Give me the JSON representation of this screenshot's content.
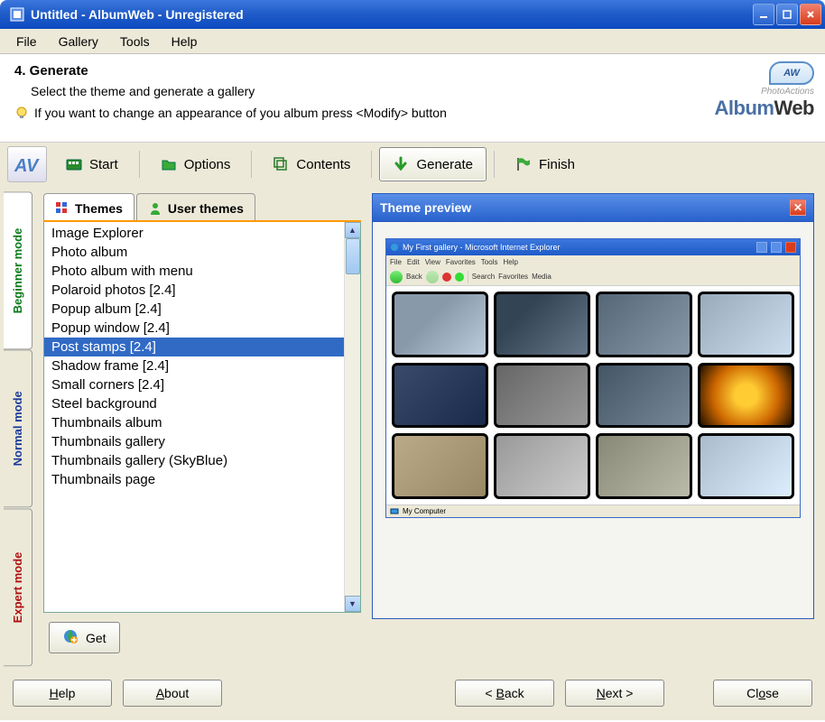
{
  "window": {
    "title": "Untitled - AlbumWeb - Unregistered"
  },
  "menubar": [
    "File",
    "Gallery",
    "Tools",
    "Help"
  ],
  "header": {
    "step": "4. Generate",
    "subtitle": "Select the theme and generate a gallery",
    "tip": "If you want to change an appearance of you album press <Modify> button",
    "brand_small": "PhotoActions",
    "brand_album": "Album",
    "brand_web": "Web",
    "brand_aw": "AW"
  },
  "toolbar": {
    "start": "Start",
    "options": "Options",
    "contents": "Contents",
    "generate": "Generate",
    "finish": "Finish"
  },
  "modes": {
    "beginner": "Beginner mode",
    "normal": "Normal mode",
    "expert": "Expert mode"
  },
  "tabs": {
    "themes": "Themes",
    "user_themes": "User themes"
  },
  "themes_list": [
    "Image Explorer",
    "Photo album",
    "Photo album with menu",
    "Polaroid photos [2.4]",
    "Popup album [2.4]",
    "Popup window [2.4]",
    "Post stamps [2.4]",
    "Shadow frame [2.4]",
    "Small corners [2.4]",
    "Steel background",
    "Thumbnails album",
    "Thumbnails gallery",
    "Thumbnails gallery (SkyBlue)",
    "Thumbnails page"
  ],
  "selected_theme_index": 6,
  "get_label": "Get",
  "preview": {
    "title": "Theme preview",
    "browser_title": "My First gallery - Microsoft Internet Explorer",
    "browser_menu": [
      "File",
      "Edit",
      "View",
      "Favorites",
      "Tools",
      "Help"
    ],
    "browser_back": "Back",
    "browser_search": "Search",
    "browser_favorites": "Favorites",
    "browser_media": "Media",
    "status": "My Computer"
  },
  "footer": {
    "help": "Help",
    "about": "About",
    "back": "< Back",
    "next": "Next >",
    "close": "Close"
  }
}
